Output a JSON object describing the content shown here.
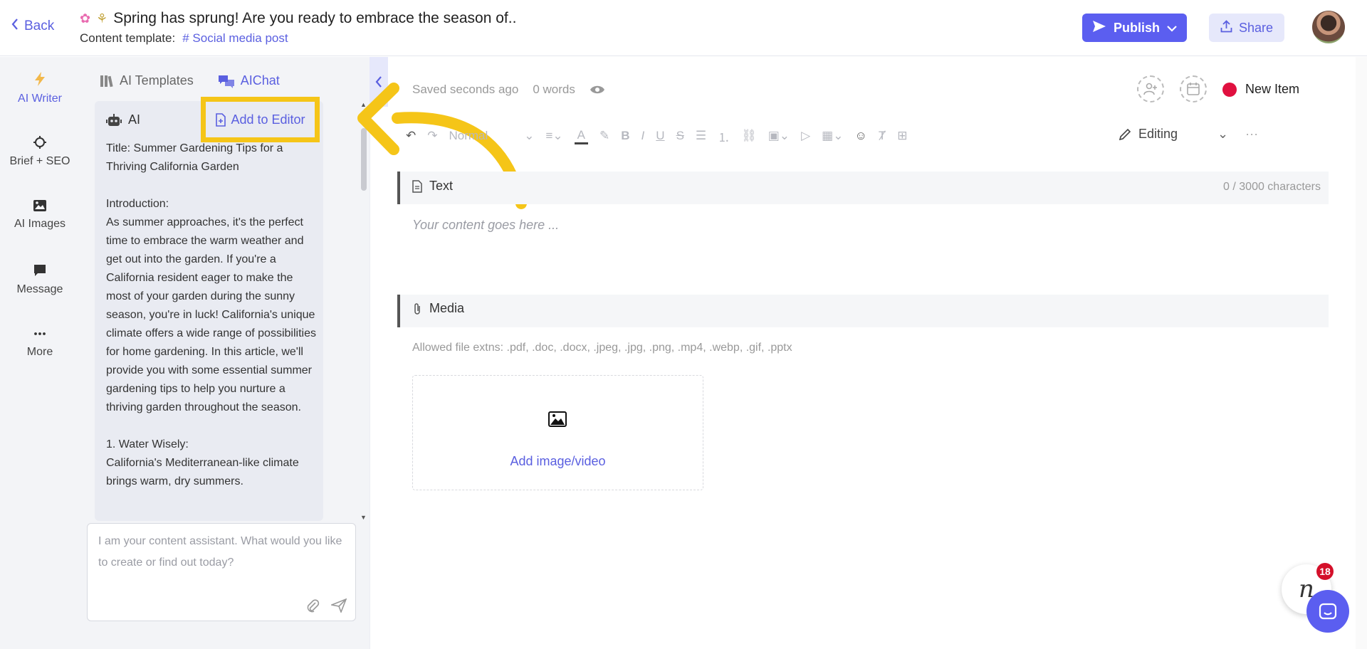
{
  "header": {
    "back_label": "Back",
    "title": "Spring has sprung! Are you ready to embrace the season of..",
    "template_label": "Content template:",
    "template_value": "Social media post",
    "publish_label": "Publish",
    "share_label": "Share"
  },
  "rail": {
    "items": [
      {
        "label": "AI Writer",
        "icon": "lightning-icon"
      },
      {
        "label": "Brief + SEO",
        "icon": "crosshair-icon"
      },
      {
        "label": "AI Images",
        "icon": "image-icon"
      },
      {
        "label": "Message",
        "icon": "chat-bubble-icon"
      },
      {
        "label": "More",
        "icon": "dots-icon"
      }
    ]
  },
  "panel": {
    "tabs": [
      {
        "label": "AI Templates",
        "icon": "books-icon"
      },
      {
        "label": "AIChat",
        "icon": "chat-icon",
        "active": true
      }
    ],
    "message": {
      "sender": "AI",
      "add_to_editor_label": "Add to Editor",
      "text": "Title: Summer Gardening Tips for a Thriving California Garden\n\nIntroduction:\nAs summer approaches, it's the perfect time to embrace the warm weather and get out into the garden. If you're a California resident eager to make the most of your garden during the sunny season, you're in luck! California's unique climate offers a wide range of possibilities for home gardening. In this article, we'll provide you with some essential summer gardening tips to help you nurture a thriving garden throughout the season.\n\n1. Water Wisely:\nCalifornia's Mediterranean-like climate brings warm, dry summers."
    },
    "chat_placeholder": "I am your content assistant. What would you like to create or find out today?"
  },
  "editor": {
    "saved_status": "Saved seconds ago",
    "word_count": "0 words",
    "new_item_label": "New Item",
    "toolbar": {
      "style_select": "Normal",
      "mode_label": "Editing"
    },
    "text_section": {
      "label": "Text",
      "char_count": "0 / 3000 characters",
      "placeholder": "Your content goes here ..."
    },
    "media_section": {
      "label": "Media",
      "allowed": "Allowed file extns: .pdf, .doc, .docx, .jpeg, .jpg, .png, .mp4, .webp, .gif, .pptx",
      "upload_label": "Add image/video"
    }
  },
  "widgets": {
    "notification_count": "18"
  },
  "colors": {
    "accent": "#5b5ef0",
    "highlight": "#f5c518",
    "status_dot": "#e0103f"
  }
}
